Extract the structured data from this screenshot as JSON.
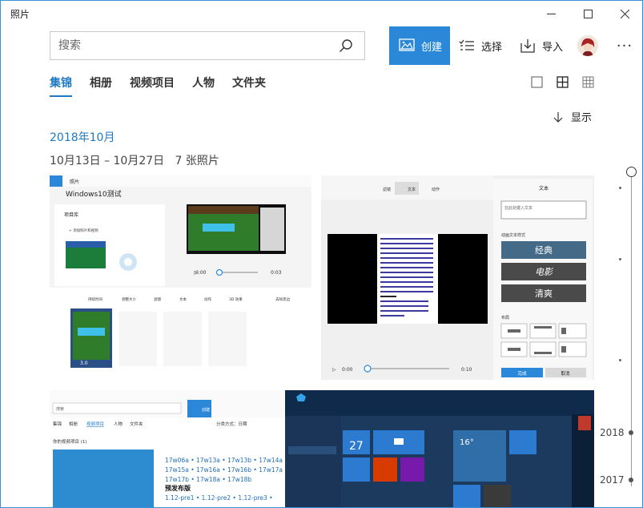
{
  "window": {
    "title": "照片",
    "minimize_symbol": "—",
    "maximize_symbol": "☐",
    "close_symbol": "✕"
  },
  "search": {
    "placeholder": "搜索",
    "icon": "search-icon"
  },
  "toolbar": {
    "create_label": "创建",
    "select_label": "选择",
    "import_label": "导入",
    "more_symbol": "···",
    "accent_color": "#2b88d8"
  },
  "nav": {
    "tabs": [
      {
        "label": "集锦",
        "active": true
      },
      {
        "label": "相册",
        "active": false
      },
      {
        "label": "视频项目",
        "active": false
      },
      {
        "label": "人物",
        "active": false
      },
      {
        "label": "文件夹",
        "active": false
      }
    ]
  },
  "view_options": {
    "show_label": "显示",
    "sizes": [
      "large-tile-icon",
      "medium-tile-icon",
      "small-tile-icon"
    ]
  },
  "collection": {
    "month": "2018年10月",
    "date_range": "10月13日 – 10月27日",
    "count": "7 张照片"
  },
  "photos": {
    "p1": {
      "app": "照片",
      "project_title": "Windows10测试",
      "library": "项目库",
      "add": "+ 添加照片和视频",
      "time_start": "0:00",
      "time_end": "0:03",
      "tools": [
        "持续时间",
        "调整大小",
        "滤镜",
        "文本",
        "动作",
        "3D 效果",
        "去除黑边"
      ],
      "clip_duration": "3.0"
    },
    "p2": {
      "tools": [
        "滤镜",
        "文本",
        "动作"
      ],
      "panel_title": "文本",
      "text_placeholder": "在此处键入文本",
      "style_heading": "动画文本样式",
      "styles": [
        "经典",
        "电影",
        "清爽"
      ],
      "layout_heading": "布局",
      "done": "完成",
      "cancel": "取消",
      "time_start": "0:00",
      "time_end": "0:10"
    },
    "p3": {
      "search": "搜索",
      "create": "创建",
      "tabs": [
        "集锦",
        "相册",
        "视频项目",
        "人物",
        "文件夹"
      ],
      "sort": "分类方式：日期",
      "section": "你的视频项目 (1)",
      "lines": [
        "17w06a • 17w13a • 17w13b • 17w14a •",
        "17w15a • 17w16a • 17w16b • 17w17a •",
        "17w17b • 17w18a • 17w18b"
      ],
      "heading": "预发布版",
      "line4": "1.12-pre1 • 1.12-pre2 • 1.12-pre3 •"
    },
    "p4": {
      "date_num": "27",
      "weather_temp": "16°"
    }
  },
  "timeline": {
    "years": [
      "2018",
      "2017"
    ]
  }
}
